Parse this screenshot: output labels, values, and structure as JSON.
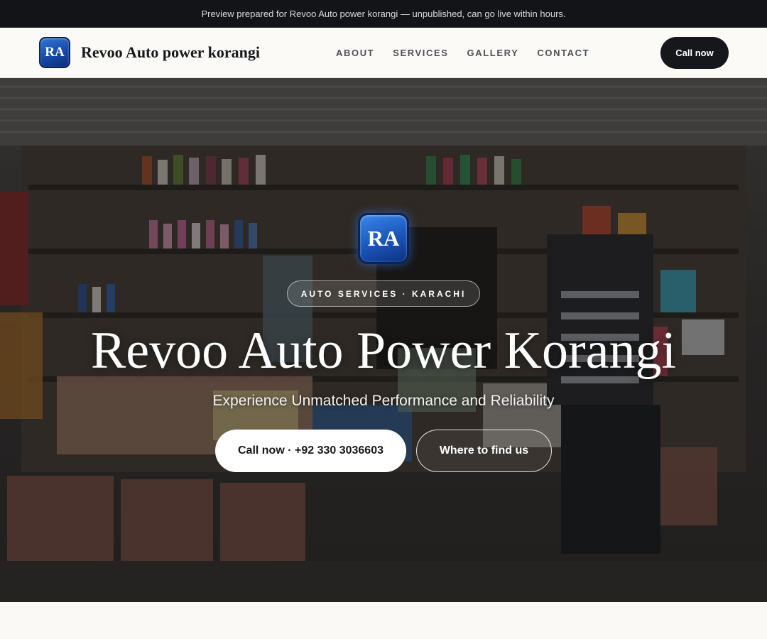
{
  "banner": {
    "text": "Preview prepared for Revoo Auto power korangi — unpublished, can go live within hours."
  },
  "nav": {
    "logo_initials": "RA",
    "brand_name": "Revoo Auto power korangi",
    "links": [
      {
        "label": "ABOUT"
      },
      {
        "label": "SERVICES"
      },
      {
        "label": "GALLERY"
      },
      {
        "label": "CONTACT"
      }
    ],
    "cta_label": "Call now"
  },
  "hero": {
    "logo_initials": "RA",
    "tagline": "AUTO SERVICES · KARACHI",
    "title": "Revoo Auto Power Korangi",
    "subtitle": "Experience Unmatched Performance and Reliability",
    "primary_button": "Call now · +92 330 3036603",
    "secondary_button": "Where to find us"
  },
  "colors": {
    "banner_bg": "#121418",
    "brand_blue": "#1a55b8",
    "dark_button": "#15171b",
    "page_bg": "#faf9f6"
  }
}
